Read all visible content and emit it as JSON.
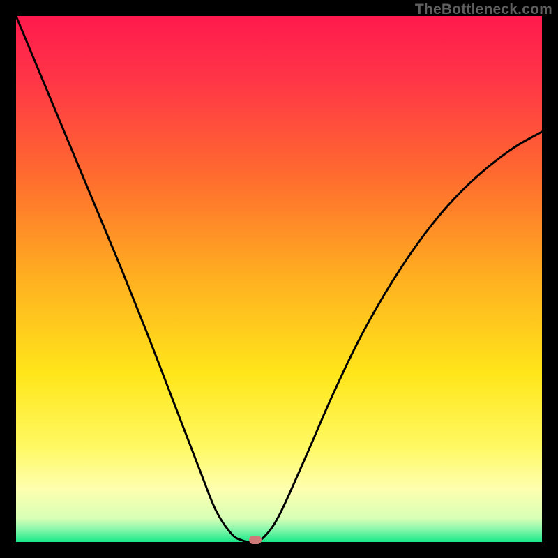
{
  "watermark": "TheBottleneck.com",
  "chart_data": {
    "type": "line",
    "title": "",
    "xlabel": "",
    "ylabel": "",
    "xlim": [
      0,
      1
    ],
    "ylim": [
      0,
      1
    ],
    "gradient_stops": [
      {
        "pos": 0.0,
        "color": "#ff1a4d"
      },
      {
        "pos": 0.12,
        "color": "#ff3547"
      },
      {
        "pos": 0.3,
        "color": "#ff6a2f"
      },
      {
        "pos": 0.5,
        "color": "#ffb020"
      },
      {
        "pos": 0.68,
        "color": "#ffe61a"
      },
      {
        "pos": 0.82,
        "color": "#fff963"
      },
      {
        "pos": 0.9,
        "color": "#feffb0"
      },
      {
        "pos": 0.955,
        "color": "#d7ffb5"
      },
      {
        "pos": 0.975,
        "color": "#8cf7ad"
      },
      {
        "pos": 1.0,
        "color": "#19e888"
      }
    ],
    "series": [
      {
        "name": "bottleneck-curve",
        "color": "#000000",
        "x": [
          0.0,
          0.05,
          0.1,
          0.15,
          0.2,
          0.25,
          0.3,
          0.35,
          0.38,
          0.41,
          0.43,
          0.45,
          0.47,
          0.5,
          0.55,
          0.6,
          0.65,
          0.7,
          0.75,
          0.8,
          0.85,
          0.9,
          0.95,
          1.0
        ],
        "y": [
          1.0,
          0.88,
          0.76,
          0.64,
          0.52,
          0.395,
          0.265,
          0.135,
          0.06,
          0.015,
          0.003,
          0.0,
          0.008,
          0.05,
          0.16,
          0.275,
          0.38,
          0.47,
          0.548,
          0.615,
          0.67,
          0.715,
          0.752,
          0.78
        ]
      }
    ],
    "marker": {
      "x": 0.455,
      "y": 0.0,
      "color": "#cf7a78"
    }
  }
}
